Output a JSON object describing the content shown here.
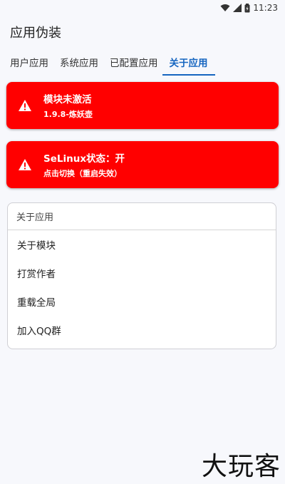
{
  "status_bar": {
    "time": "11:23"
  },
  "app": {
    "title": "应用伪装"
  },
  "tabs": [
    {
      "label": "用户应用"
    },
    {
      "label": "系统应用"
    },
    {
      "label": "已配置应用"
    },
    {
      "label": "关于应用"
    }
  ],
  "alerts": [
    {
      "title": "模块未激活",
      "subtitle": "1.9.8-炼妖壶"
    },
    {
      "title": "SeLinux状态：开",
      "subtitle": "点击切换（重启失效）"
    }
  ],
  "about_card": {
    "header": "关于应用",
    "items": [
      {
        "label": "关于模块"
      },
      {
        "label": "打赏作者"
      },
      {
        "label": "重载全局"
      },
      {
        "label": "加入QQ群"
      }
    ]
  },
  "watermark": {
    "text": "大玩客"
  },
  "colors": {
    "alert_red": "#ff0000",
    "tab_accent": "#1565c0"
  }
}
